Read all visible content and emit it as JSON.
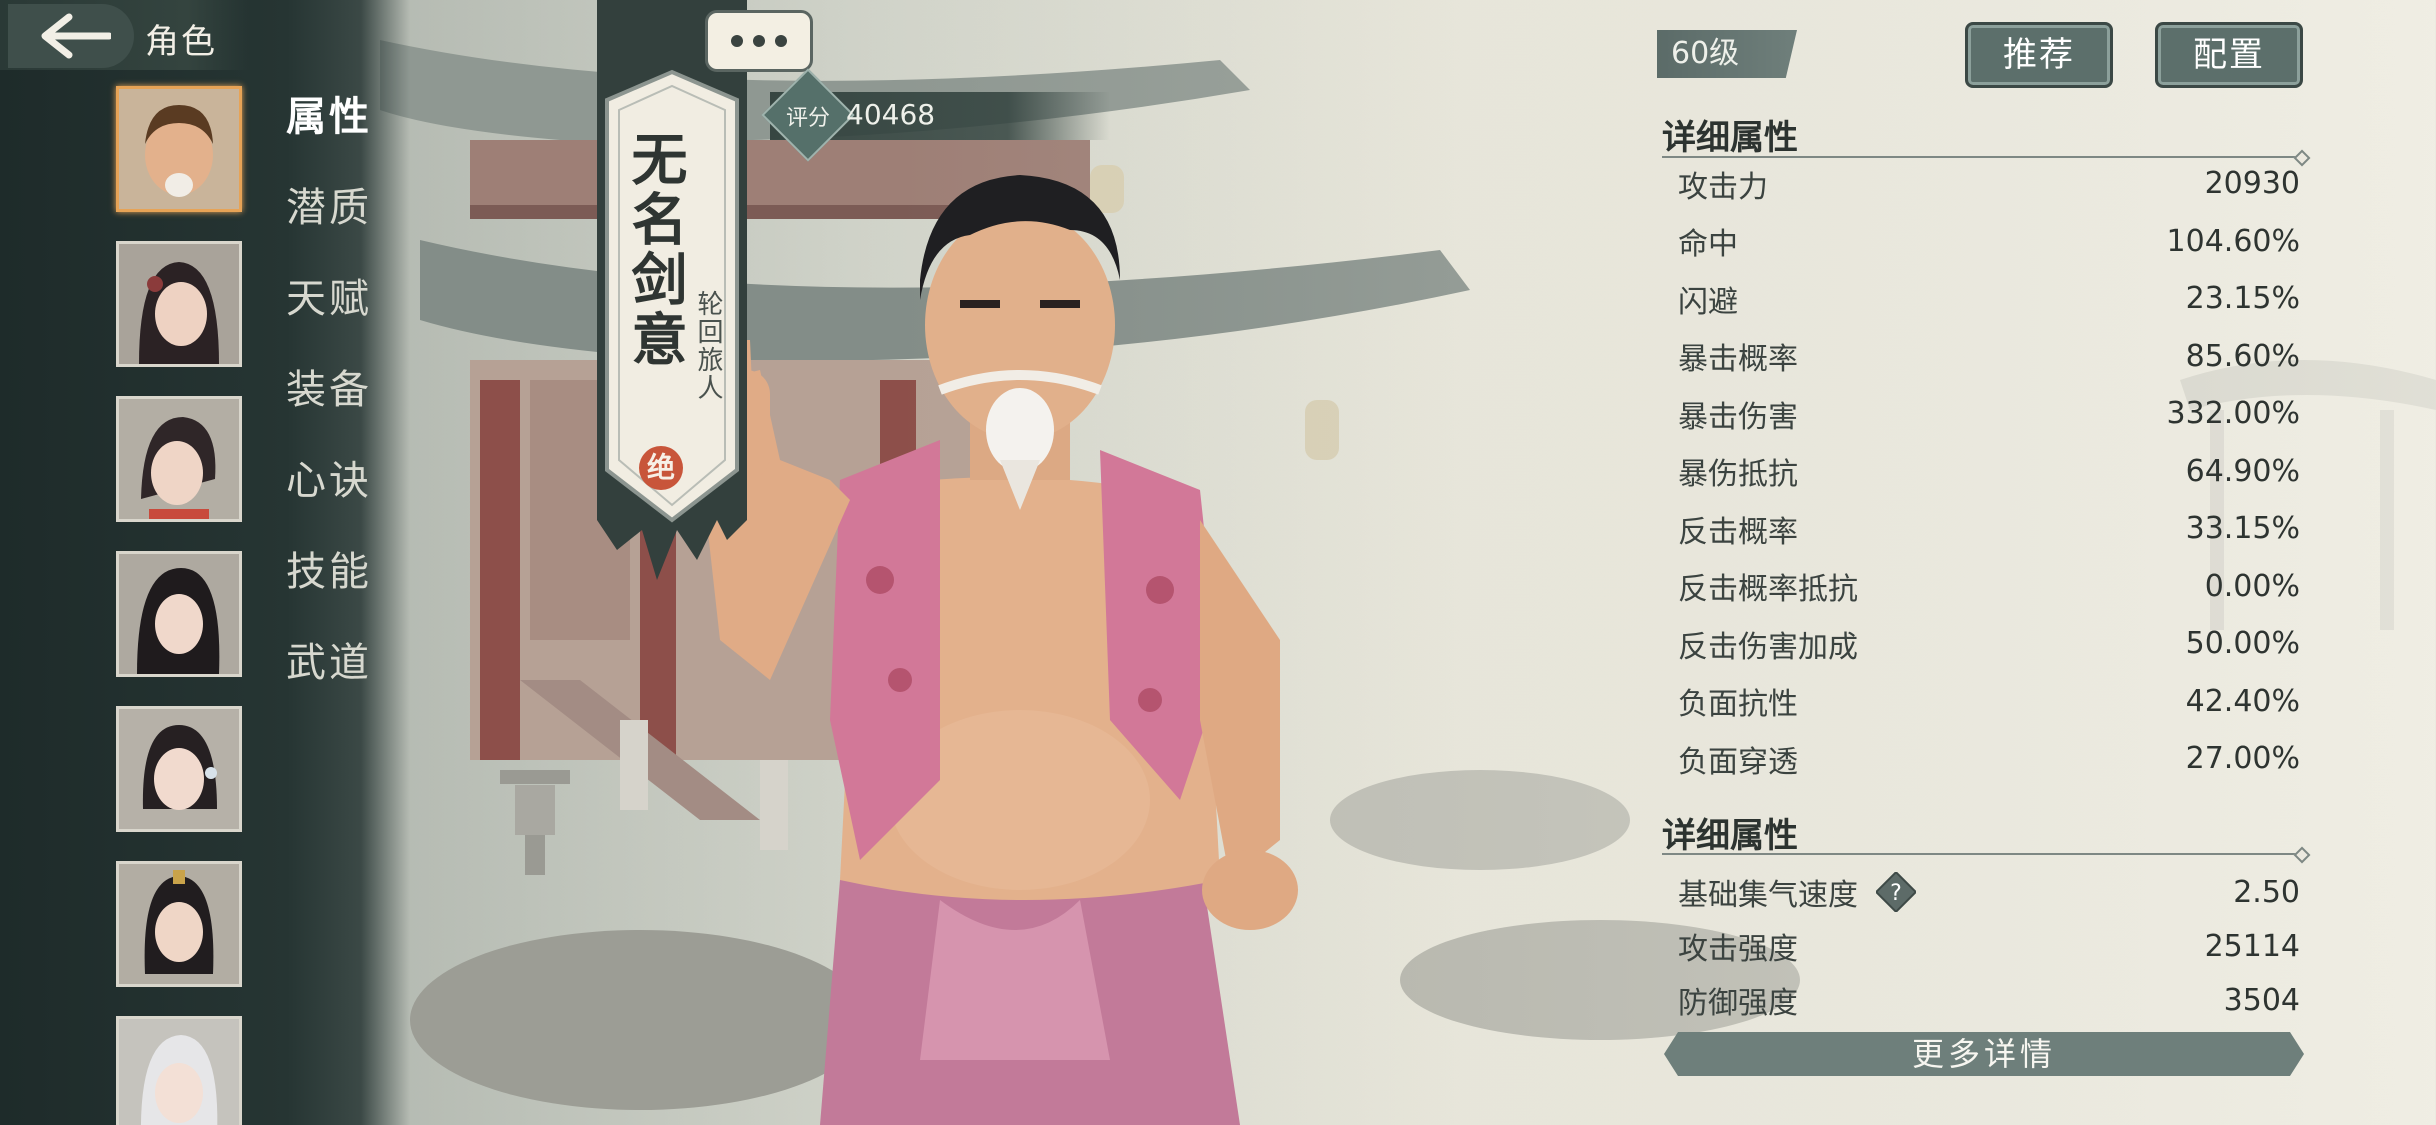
{
  "header": {
    "title": "角色"
  },
  "sidebar": {
    "menu": [
      {
        "label": "属性",
        "active": true
      },
      {
        "label": "潜质",
        "active": false
      },
      {
        "label": "天赋",
        "active": false
      },
      {
        "label": "装备",
        "active": false
      },
      {
        "label": "心诀",
        "active": false
      },
      {
        "label": "技能",
        "active": false
      },
      {
        "label": "武道",
        "active": false
      }
    ]
  },
  "character": {
    "banner_name": "无名剑意",
    "banner_title": "轮回旅人",
    "rarity": "绝",
    "score_label": "评分",
    "score": "40468"
  },
  "panel": {
    "level": "60级",
    "recommend_label": "推荐",
    "config_label": "配置",
    "section1_title": "详细属性",
    "stats": [
      {
        "name": "攻击力",
        "value": "20930"
      },
      {
        "name": "命中",
        "value": "104.60%"
      },
      {
        "name": "闪避",
        "value": "23.15%"
      },
      {
        "name": "暴击概率",
        "value": "85.60%"
      },
      {
        "name": "暴击伤害",
        "value": "332.00%"
      },
      {
        "name": "暴伤抵抗",
        "value": "64.90%"
      },
      {
        "name": "反击概率",
        "value": "33.15%"
      },
      {
        "name": "反击概率抵抗",
        "value": "0.00%"
      },
      {
        "name": "反击伤害加成",
        "value": "50.00%"
      },
      {
        "name": "负面抗性",
        "value": "42.40%"
      },
      {
        "name": "负面穿透",
        "value": "27.00%"
      }
    ],
    "section2_title": "详细属性",
    "stats2": [
      {
        "name": "基础集气速度",
        "value": "2.50"
      },
      {
        "name": "攻击强度",
        "value": "25114"
      },
      {
        "name": "防御强度",
        "value": "3504"
      }
    ],
    "more_label": "更多详情"
  },
  "colors": {
    "sidebar_bg": "#263533",
    "active_portrait_border": "#e7a356",
    "button_bg": "#5c6f6b",
    "rarity_seal": "#c8553a"
  }
}
